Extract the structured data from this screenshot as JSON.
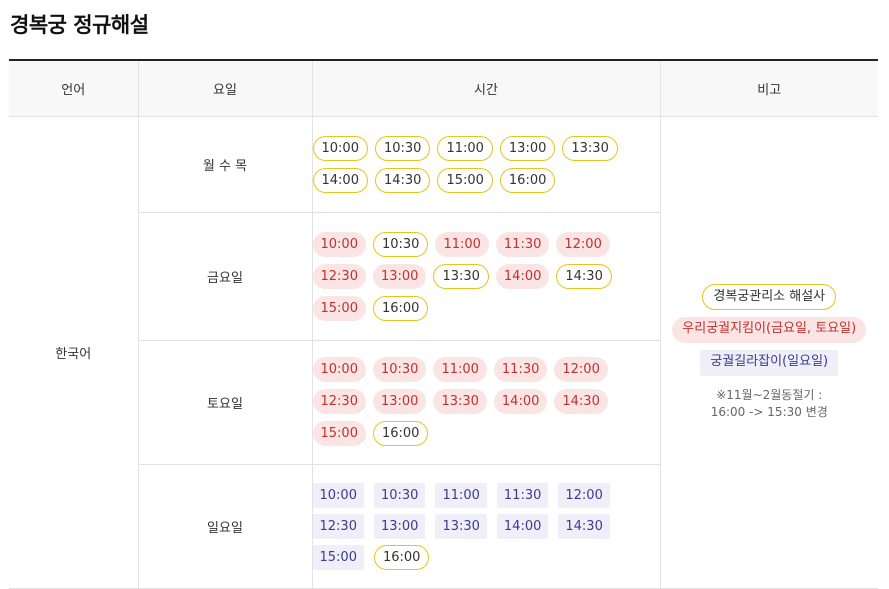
{
  "page": {
    "title": "경복궁 정규해설"
  },
  "table": {
    "headers": {
      "lang": "언어",
      "day": "요일",
      "time": "시간",
      "note": "비고"
    },
    "language": "한국어",
    "rows": [
      {
        "day": "월 수 목",
        "times": [
          {
            "t": "10:00",
            "k": "y"
          },
          {
            "t": "10:30",
            "k": "y"
          },
          {
            "t": "11:00",
            "k": "y"
          },
          {
            "t": "13:00",
            "k": "y"
          },
          {
            "t": "13:30",
            "k": "y"
          },
          {
            "t": "14:00",
            "k": "y"
          },
          {
            "t": "14:30",
            "k": "y"
          },
          {
            "t": "15:00",
            "k": "y"
          },
          {
            "t": "16:00",
            "k": "y"
          }
        ]
      },
      {
        "day": "금요일",
        "times": [
          {
            "t": "10:00",
            "k": "r"
          },
          {
            "t": "10:30",
            "k": "y"
          },
          {
            "t": "11:00",
            "k": "r"
          },
          {
            "t": "11:30",
            "k": "r"
          },
          {
            "t": "12:00",
            "k": "r"
          },
          {
            "t": "12:30",
            "k": "r"
          },
          {
            "t": "13:00",
            "k": "r"
          },
          {
            "t": "13:30",
            "k": "y"
          },
          {
            "t": "14:00",
            "k": "r"
          },
          {
            "t": "14:30",
            "k": "y"
          },
          {
            "t": "15:00",
            "k": "r"
          },
          {
            "t": "16:00",
            "k": "y"
          }
        ]
      },
      {
        "day": "토요일",
        "times": [
          {
            "t": "10:00",
            "k": "r"
          },
          {
            "t": "10:30",
            "k": "r"
          },
          {
            "t": "11:00",
            "k": "r"
          },
          {
            "t": "11:30",
            "k": "r"
          },
          {
            "t": "12:00",
            "k": "r"
          },
          {
            "t": "12:30",
            "k": "r"
          },
          {
            "t": "13:00",
            "k": "r"
          },
          {
            "t": "13:30",
            "k": "r"
          },
          {
            "t": "14:00",
            "k": "r"
          },
          {
            "t": "14:30",
            "k": "r"
          },
          {
            "t": "15:00",
            "k": "r"
          },
          {
            "t": "16:00",
            "k": "y"
          }
        ]
      },
      {
        "day": "일요일",
        "times": [
          {
            "t": "10:00",
            "k": "b"
          },
          {
            "t": "10:30",
            "k": "b"
          },
          {
            "t": "11:00",
            "k": "b"
          },
          {
            "t": "11:30",
            "k": "b"
          },
          {
            "t": "12:00",
            "k": "b"
          },
          {
            "t": "12:30",
            "k": "b"
          },
          {
            "t": "13:00",
            "k": "b"
          },
          {
            "t": "13:30",
            "k": "b"
          },
          {
            "t": "14:00",
            "k": "b"
          },
          {
            "t": "14:30",
            "k": "b"
          },
          {
            "t": "15:00",
            "k": "b"
          },
          {
            "t": "16:00",
            "k": "y"
          }
        ]
      }
    ]
  },
  "notes": {
    "badges": [
      {
        "label": "경복궁관리소 해설사",
        "k": "y"
      },
      {
        "label": "우리궁궐지킴이(금요일, 토요일)",
        "k": "r"
      },
      {
        "label": "궁궐길라잡이(일요일)",
        "k": "b"
      }
    ],
    "winter_line1": "※11월~2월동절기 :",
    "winter_line2": "16:00 -> 15:30 변경"
  },
  "colors": {
    "yellow_outline": "#e7c51d",
    "red_bg": "#fbe4e4",
    "red_text": "#c0322f",
    "blue_bg": "#efeef9",
    "blue_text": "#3a3c8e"
  }
}
